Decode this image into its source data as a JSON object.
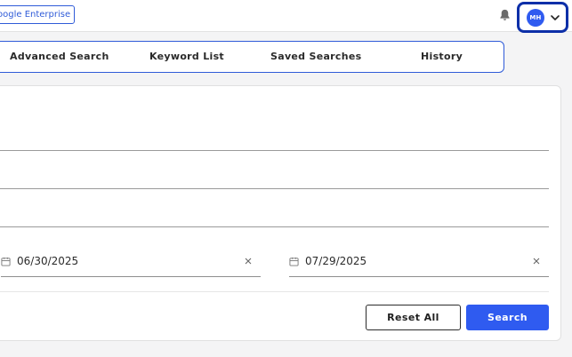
{
  "header": {
    "org_badge": "oogle Enterprise",
    "user_initials": "MH"
  },
  "tabs": [
    {
      "label": "Advanced Search"
    },
    {
      "label": "Keyword List"
    },
    {
      "label": "Saved Searches"
    },
    {
      "label": "History"
    }
  ],
  "form": {
    "start_date": "06/30/2025",
    "end_date": "07/29/2025"
  },
  "actions": {
    "reset_label": "Reset All",
    "search_label": "Search"
  },
  "colors": {
    "accent": "#2f5bf0",
    "focus_ring": "#0d2fa8",
    "badge_border": "#2f5bd8"
  },
  "icons": {
    "notifications": "bell-icon",
    "user_menu": "chevron-down-icon",
    "date": "calendar-icon",
    "clear": "close-icon"
  }
}
